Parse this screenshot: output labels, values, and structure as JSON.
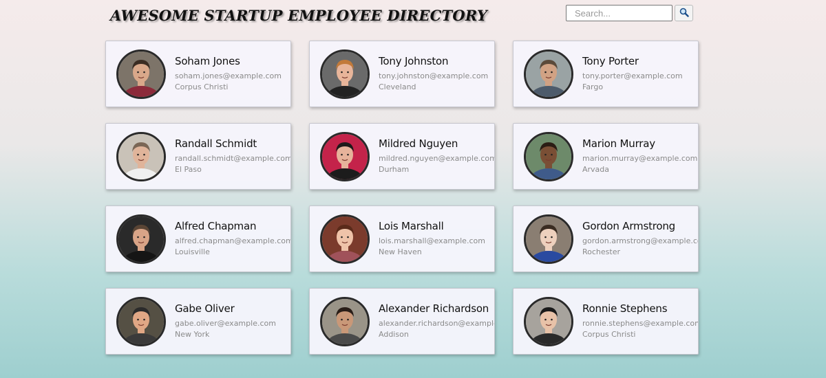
{
  "header": {
    "title": "AWESOME STARTUP EMPLOYEE DIRECTORY"
  },
  "search": {
    "placeholder": "Search...",
    "value": "",
    "button_icon": "magnifier-icon"
  },
  "employees": [
    {
      "name": "Soham Jones",
      "email": "soham.jones@example.com",
      "city": "Corpus Christi",
      "avatar_colors": {
        "bg": "#7d7469",
        "skin": "#d9a88a",
        "hair": "#3a2c22",
        "shirt": "#8c2a3a"
      }
    },
    {
      "name": "Tony Johnston",
      "email": "tony.johnston@example.com",
      "city": "Cleveland",
      "avatar_colors": {
        "bg": "#6a6a6a",
        "skin": "#e8b59a",
        "hair": "#c27a3a",
        "shirt": "#222222"
      }
    },
    {
      "name": "Tony Porter",
      "email": "tony.porter@example.com",
      "city": "Fargo",
      "avatar_colors": {
        "bg": "#9aa3a4",
        "skin": "#d1a284",
        "hair": "#5b4a3a",
        "shirt": "#4d5b6b"
      }
    },
    {
      "name": "Randall Schmidt",
      "email": "randall.schmidt@example.com",
      "city": "El Paso",
      "avatar_colors": {
        "bg": "#c9c2b8",
        "skin": "#e0b49a",
        "hair": "#7a6655",
        "shirt": "#f0f0f0"
      }
    },
    {
      "name": "Mildred Nguyen",
      "email": "mildred.nguyen@example.com",
      "city": "Durham",
      "avatar_colors": {
        "bg": "#c4234a",
        "skin": "#e6b39b",
        "hair": "#1e1a1a",
        "shirt": "#1c1c1c"
      }
    },
    {
      "name": "Marion Murray",
      "email": "marion.murray@example.com",
      "city": "Arvada",
      "avatar_colors": {
        "bg": "#6d8a6a",
        "skin": "#7a4f35",
        "hair": "#2b1d14",
        "shirt": "#3f5b8a"
      }
    },
    {
      "name": "Alfred Chapman",
      "email": "alfred.chapman@example.com",
      "city": "Louisville",
      "avatar_colors": {
        "bg": "#2a2a2a",
        "skin": "#d9a487",
        "hair": "#5a4535",
        "shirt": "#151515"
      }
    },
    {
      "name": "Lois Marshall",
      "email": "lois.marshall@example.com",
      "city": "New Haven",
      "avatar_colors": {
        "bg": "#7b3b2c",
        "skin": "#efc3a9",
        "hair": "#5a2a1a",
        "shirt": "#a0525a"
      }
    },
    {
      "name": "Gordon Armstrong",
      "email": "gordon.armstrong@example.com",
      "city": "Rochester",
      "avatar_colors": {
        "bg": "#8a7e72",
        "skin": "#edd0bd",
        "hair": "#3a2c22",
        "shirt": "#2a4aa0"
      }
    },
    {
      "name": "Gabe Oliver",
      "email": "gabe.oliver@example.com",
      "city": "New York",
      "avatar_colors": {
        "bg": "#555044",
        "skin": "#e0a785",
        "hair": "#2b2b2b",
        "shirt": "#3a3a3a"
      }
    },
    {
      "name": "Alexander Richardson",
      "email": "alexander.richardson@example.com",
      "city": "Addison",
      "avatar_colors": {
        "bg": "#9a9488",
        "skin": "#c99878",
        "hair": "#2a1e18",
        "shirt": "#4a4a4a"
      }
    },
    {
      "name": "Ronnie Stephens",
      "email": "ronnie.stephens@example.com",
      "city": "Corpus Christi",
      "avatar_colors": {
        "bg": "#a7a39d",
        "skin": "#e8c2a8",
        "hair": "#1a1a1a",
        "shirt": "#2a2a2a"
      }
    }
  ]
}
